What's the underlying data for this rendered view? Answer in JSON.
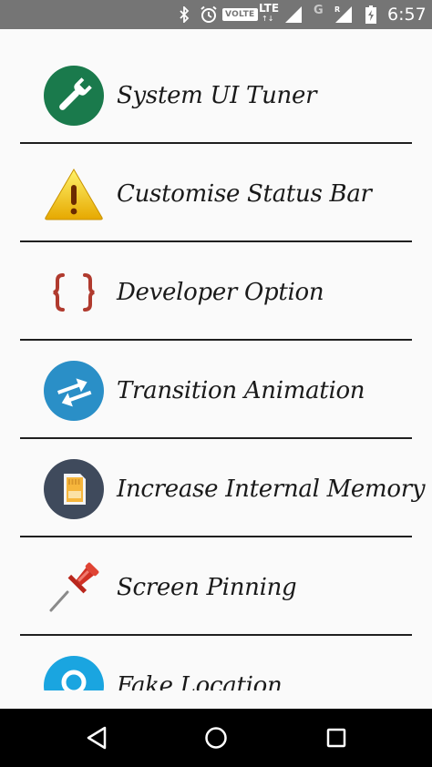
{
  "status_bar": {
    "volte": "VOLTE",
    "lte": "LTE",
    "lte_arrows": "↑↓",
    "network_g": "G",
    "roaming": "R",
    "time": "6:57"
  },
  "menu": {
    "items": [
      {
        "label": "System UI Tuner",
        "icon": "wrench-icon",
        "color": "#1a7a4c"
      },
      {
        "label": "Customise Status Bar",
        "icon": "warning-icon",
        "color": "#f0c419"
      },
      {
        "label": "Developer Option",
        "icon": "braces-icon",
        "color": "#b03a2e"
      },
      {
        "label": "Transition Animation",
        "icon": "swap-arrows-icon",
        "color": "#2a8fc7"
      },
      {
        "label": "Increase Internal Memory",
        "icon": "sd-card-icon",
        "color": "#3f4a5c"
      },
      {
        "label": "Screen Pinning",
        "icon": "pushpin-icon",
        "color": "#d8342a"
      },
      {
        "label": "Fake Location",
        "icon": "location-pin-icon",
        "color": "#1aa5e0"
      }
    ]
  },
  "nav": {
    "back": "back",
    "home": "home",
    "recents": "recents"
  }
}
